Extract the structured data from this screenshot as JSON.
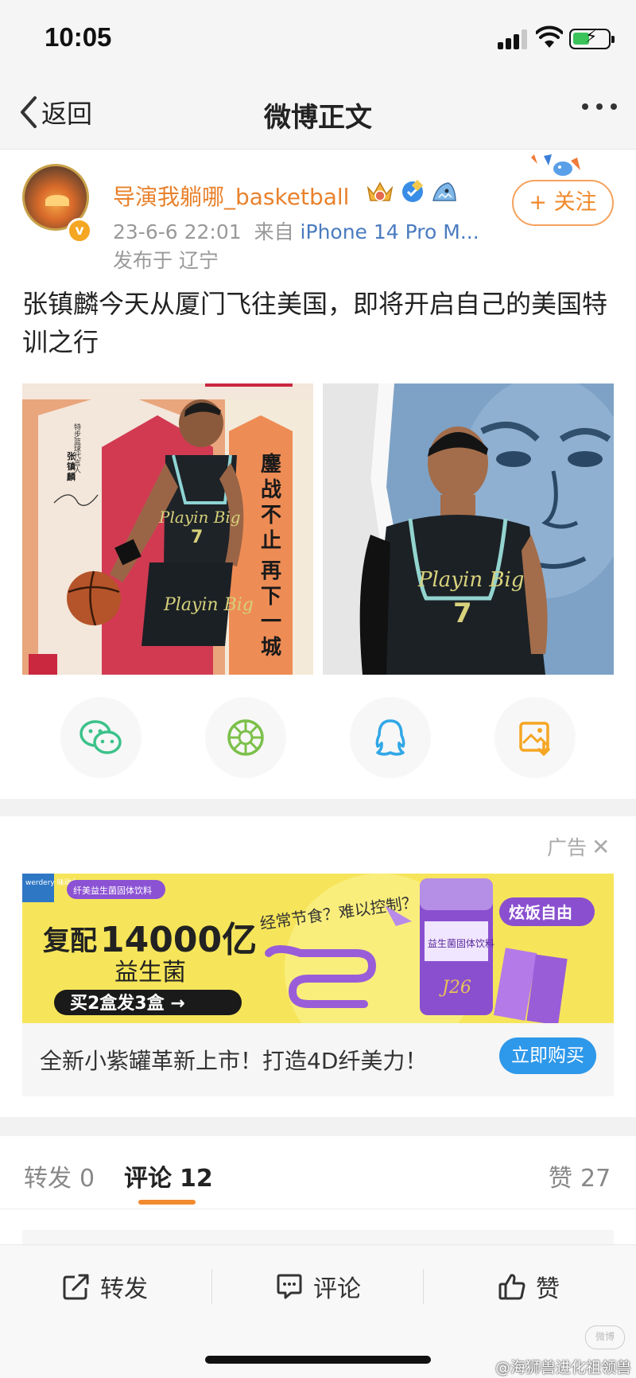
{
  "status_bar": {
    "time": "10:05"
  },
  "nav": {
    "back_label": "返回",
    "title": "微博正文"
  },
  "post": {
    "username": "导演我躺哪_basketball",
    "timestamp": "23-6-6 22:01",
    "source_prefix": "来自",
    "source": "iPhone 14 Pro M...",
    "location": "发布于 辽宁",
    "follow_label": "+ 关注",
    "text": "张镇麟今天从厦门飞往美国，即将开启自己的美国特训之行",
    "image1_text": {
      "vertical": "鏖战不止 再下一城",
      "side": "特步篮球代言人",
      "name": "张镇麟"
    },
    "image2_text": {
      "jersey_script": "Playin Big",
      "jersey_number": "7"
    }
  },
  "share": {
    "wechat_icon": "wechat-icon",
    "moments_icon": "moments-icon",
    "qq_icon": "qq-icon",
    "save_icon": "save-image-icon"
  },
  "ad": {
    "label": "广告",
    "banner": {
      "brand": "werdery 味动力",
      "tag": "纤美益生菌固体饮料",
      "headline_prefix": "复配",
      "headline_number": "14000亿",
      "headline_sub": "益生菌",
      "deal": "买2盒发3盒 →",
      "question": "经常节食？难以控制？",
      "slogan": "炫饭自由",
      "product_label": "益生菌固体饮料"
    },
    "text": "全新小紫罐革新上市！打造4D纤美力！",
    "cta": "立即购买"
  },
  "tabs": {
    "repost": {
      "label": "转发",
      "count": "0"
    },
    "comment": {
      "label": "评论",
      "count": "12"
    },
    "like": {
      "label": "赞",
      "count": "27"
    }
  },
  "bottom_bar": {
    "repost": "转发",
    "comment": "评论",
    "like": "赞"
  },
  "watermark": "@海狮兽进化祖领兽",
  "colors": {
    "accent": "#f28a2f",
    "username": "#e8812c",
    "link": "#4a7bbf",
    "button_blue": "#2e98ea"
  }
}
